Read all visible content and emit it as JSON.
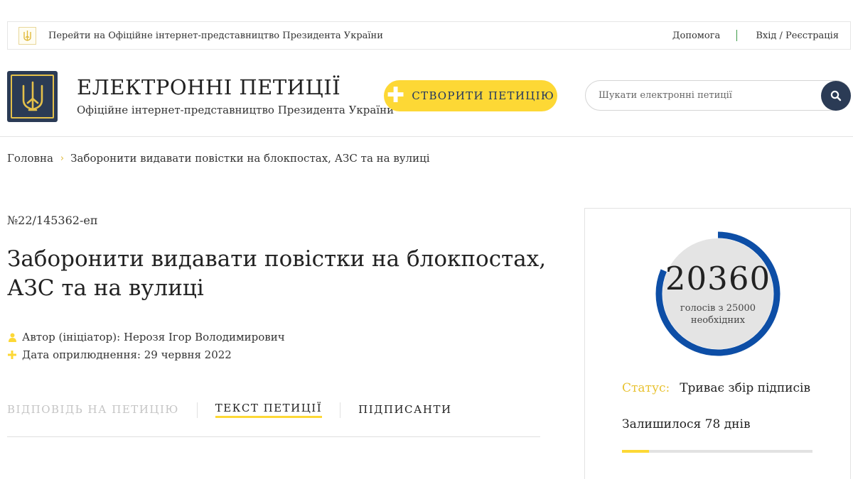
{
  "topbar": {
    "official_link": "Перейти на Офіційне інтернет-представництво Президента України",
    "help": "Допомога",
    "login": "Вхід / Реєстрація"
  },
  "header": {
    "title": "ЕЛЕКТРОННІ ПЕТИЦІЇ",
    "subtitle": "Офіційне інтернет-представництво Президента України",
    "create_button": "СТВОРИТИ ПЕТИЦІЮ",
    "search_placeholder": "Шукати електронні петиції"
  },
  "breadcrumb": {
    "home": "Головна",
    "current": "Заборонити видавати повістки на блокпостах, АЗС та на вулиці"
  },
  "petition": {
    "number": "№22/145362-еп",
    "title": "Заборонити видавати повістки на блокпостах, АЗС та на вулиці",
    "author": "Автор (ініціатор): Нерозя Ігор Володимирович",
    "date": "Дата оприлюднення: 29 червня 2022"
  },
  "tabs": [
    {
      "label": "ВІДПОВІДЬ НА ПЕТИЦІЮ",
      "state": "disabled"
    },
    {
      "label": "ТЕКСТ ПЕТИЦІЇ",
      "state": "active"
    },
    {
      "label": "ПІДПИСАНТИ",
      "state": "normal"
    }
  ],
  "sidebar": {
    "votes": "20360",
    "votes_caption_line1": "голосів з 25000",
    "votes_caption_line2": "необхідних",
    "votes_count": 20360,
    "votes_required": 25000,
    "status_label": "Статус:",
    "status_value": "Триває збір підписів",
    "remaining": "Залишилося 78 днів",
    "days_progress": 0.14
  },
  "colors": {
    "accent_yellow": "#fdd835",
    "navy": "#2b3b55",
    "ring_blue": "#0d4ea6",
    "ring_bg": "#e4e4e4"
  },
  "icons": [
    "trident-emblem-icon",
    "plus-icon",
    "search-icon",
    "user-icon",
    "chevron-right-icon"
  ]
}
